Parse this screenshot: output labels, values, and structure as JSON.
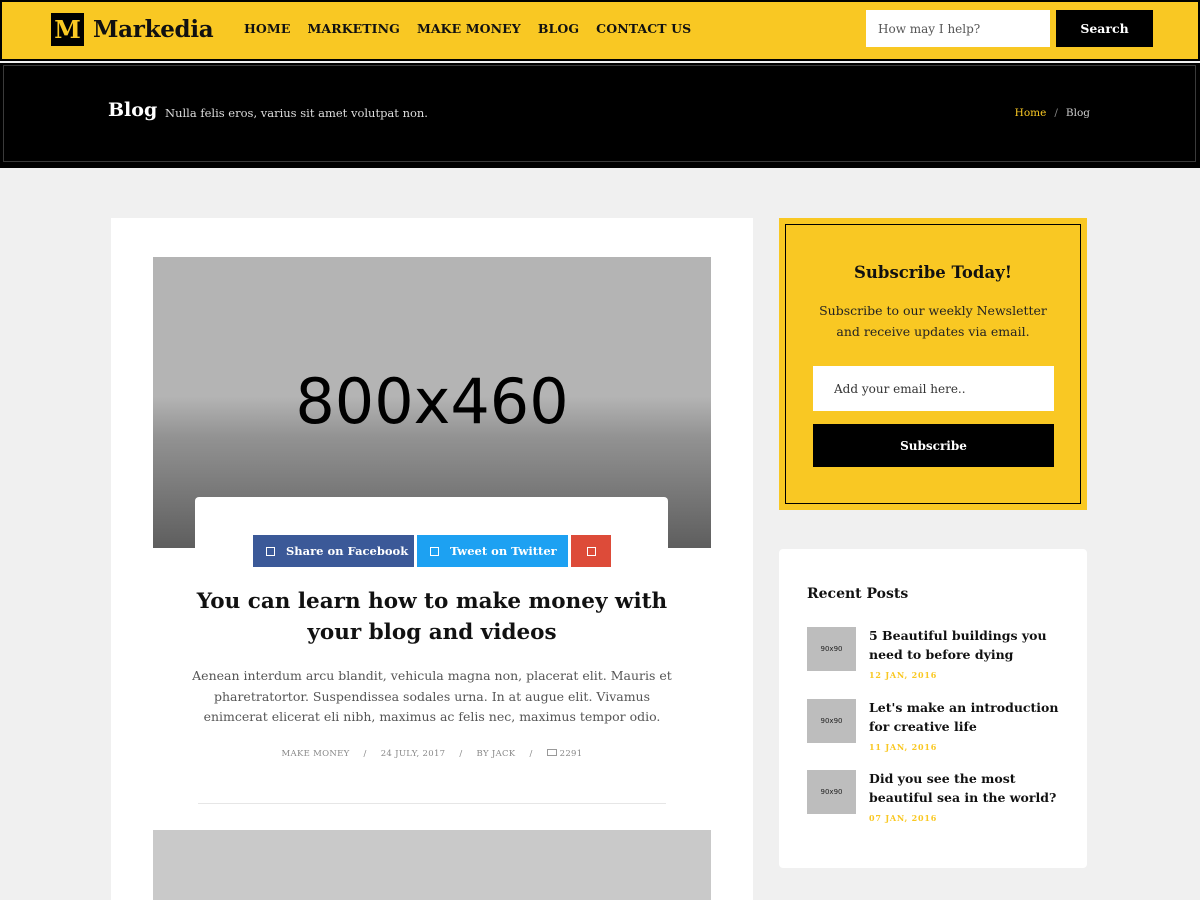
{
  "header": {
    "logo_letter": "M",
    "logo_text": "Markedia",
    "nav": [
      "HOME",
      "MARKETING",
      "MAKE MONEY",
      "BLOG",
      "CONTACT US"
    ],
    "search_placeholder": "How may I help?",
    "search_label": "Search"
  },
  "banner": {
    "title": "Blog",
    "subtitle": "Nulla felis eros, varius sit amet volutpat non.",
    "breadcrumb_home": "Home",
    "breadcrumb_sep": "/",
    "breadcrumb_current": "Blog"
  },
  "post": {
    "image_label": "800x460",
    "share_facebook": "Share on Facebook",
    "share_twitter": "Tweet on Twitter",
    "title": "You can learn how to make money with your blog and videos",
    "excerpt": "Aenean interdum arcu blandit, vehicula magna non, placerat elit. Mauris et pharetratortor. Suspendissea sodales urna. In at augue elit. Vivamus enimcerat elicerat eli nibh, maximus ac felis nec, maximus tempor odio.",
    "category": "MAKE MONEY",
    "date": "24 JULY, 2017",
    "author": "BY JACK",
    "comments": "2291",
    "meta_sep": "/"
  },
  "subscribe": {
    "title": "Subscribe Today!",
    "text": "Subscribe to our weekly Newsletter and receive updates via email.",
    "email_placeholder": "Add your email here..",
    "button_label": "Subscribe"
  },
  "recent": {
    "title": "Recent Posts",
    "items": [
      {
        "thumb": "90x90",
        "title": "5 Beautiful buildings you need to before dying",
        "date": "12 JAN, 2016"
      },
      {
        "thumb": "90x90",
        "title": "Let's make an introduction for creative life",
        "date": "11 JAN, 2016"
      },
      {
        "thumb": "90x90",
        "title": "Did you see the most beautiful sea in the world?",
        "date": "07 JAN, 2016"
      }
    ]
  },
  "colors": {
    "accent": "#f9c823",
    "facebook": "#3b5998",
    "twitter": "#1da1f2",
    "google": "#dd4b39"
  }
}
